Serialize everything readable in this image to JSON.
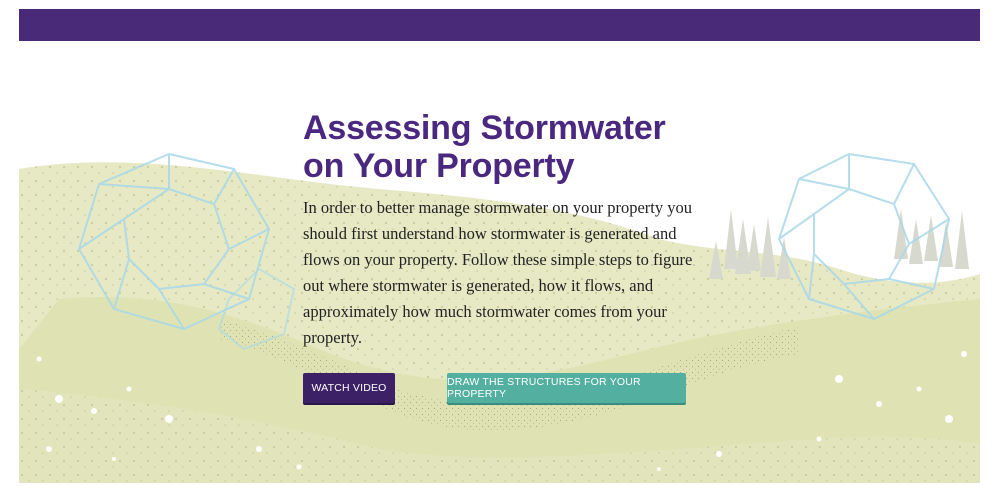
{
  "header": {
    "bar_color": "#482a78"
  },
  "hero": {
    "title_line1": "Assessing Stormwater",
    "title_line2": "on Your Property",
    "body": "In order to better manage stormwater on your property you should first understand how stormwater is generated and flows on your property. Follow these simple steps to figure out where stormwater is generated, how it flows, and approximately how much stormwater comes from your property."
  },
  "actions": {
    "watch_video_label": "WATCH VIDEO",
    "draw_structures_label": "DRAW THE STRUCTURES FOR YOUR PROPERTY"
  },
  "colors": {
    "title": "#4b2880",
    "watch_button": "#3d2167",
    "draw_button": "#53b0a0",
    "hill_green": "#e4e8c0",
    "polyhedron_blue": "#a9d8e8"
  }
}
